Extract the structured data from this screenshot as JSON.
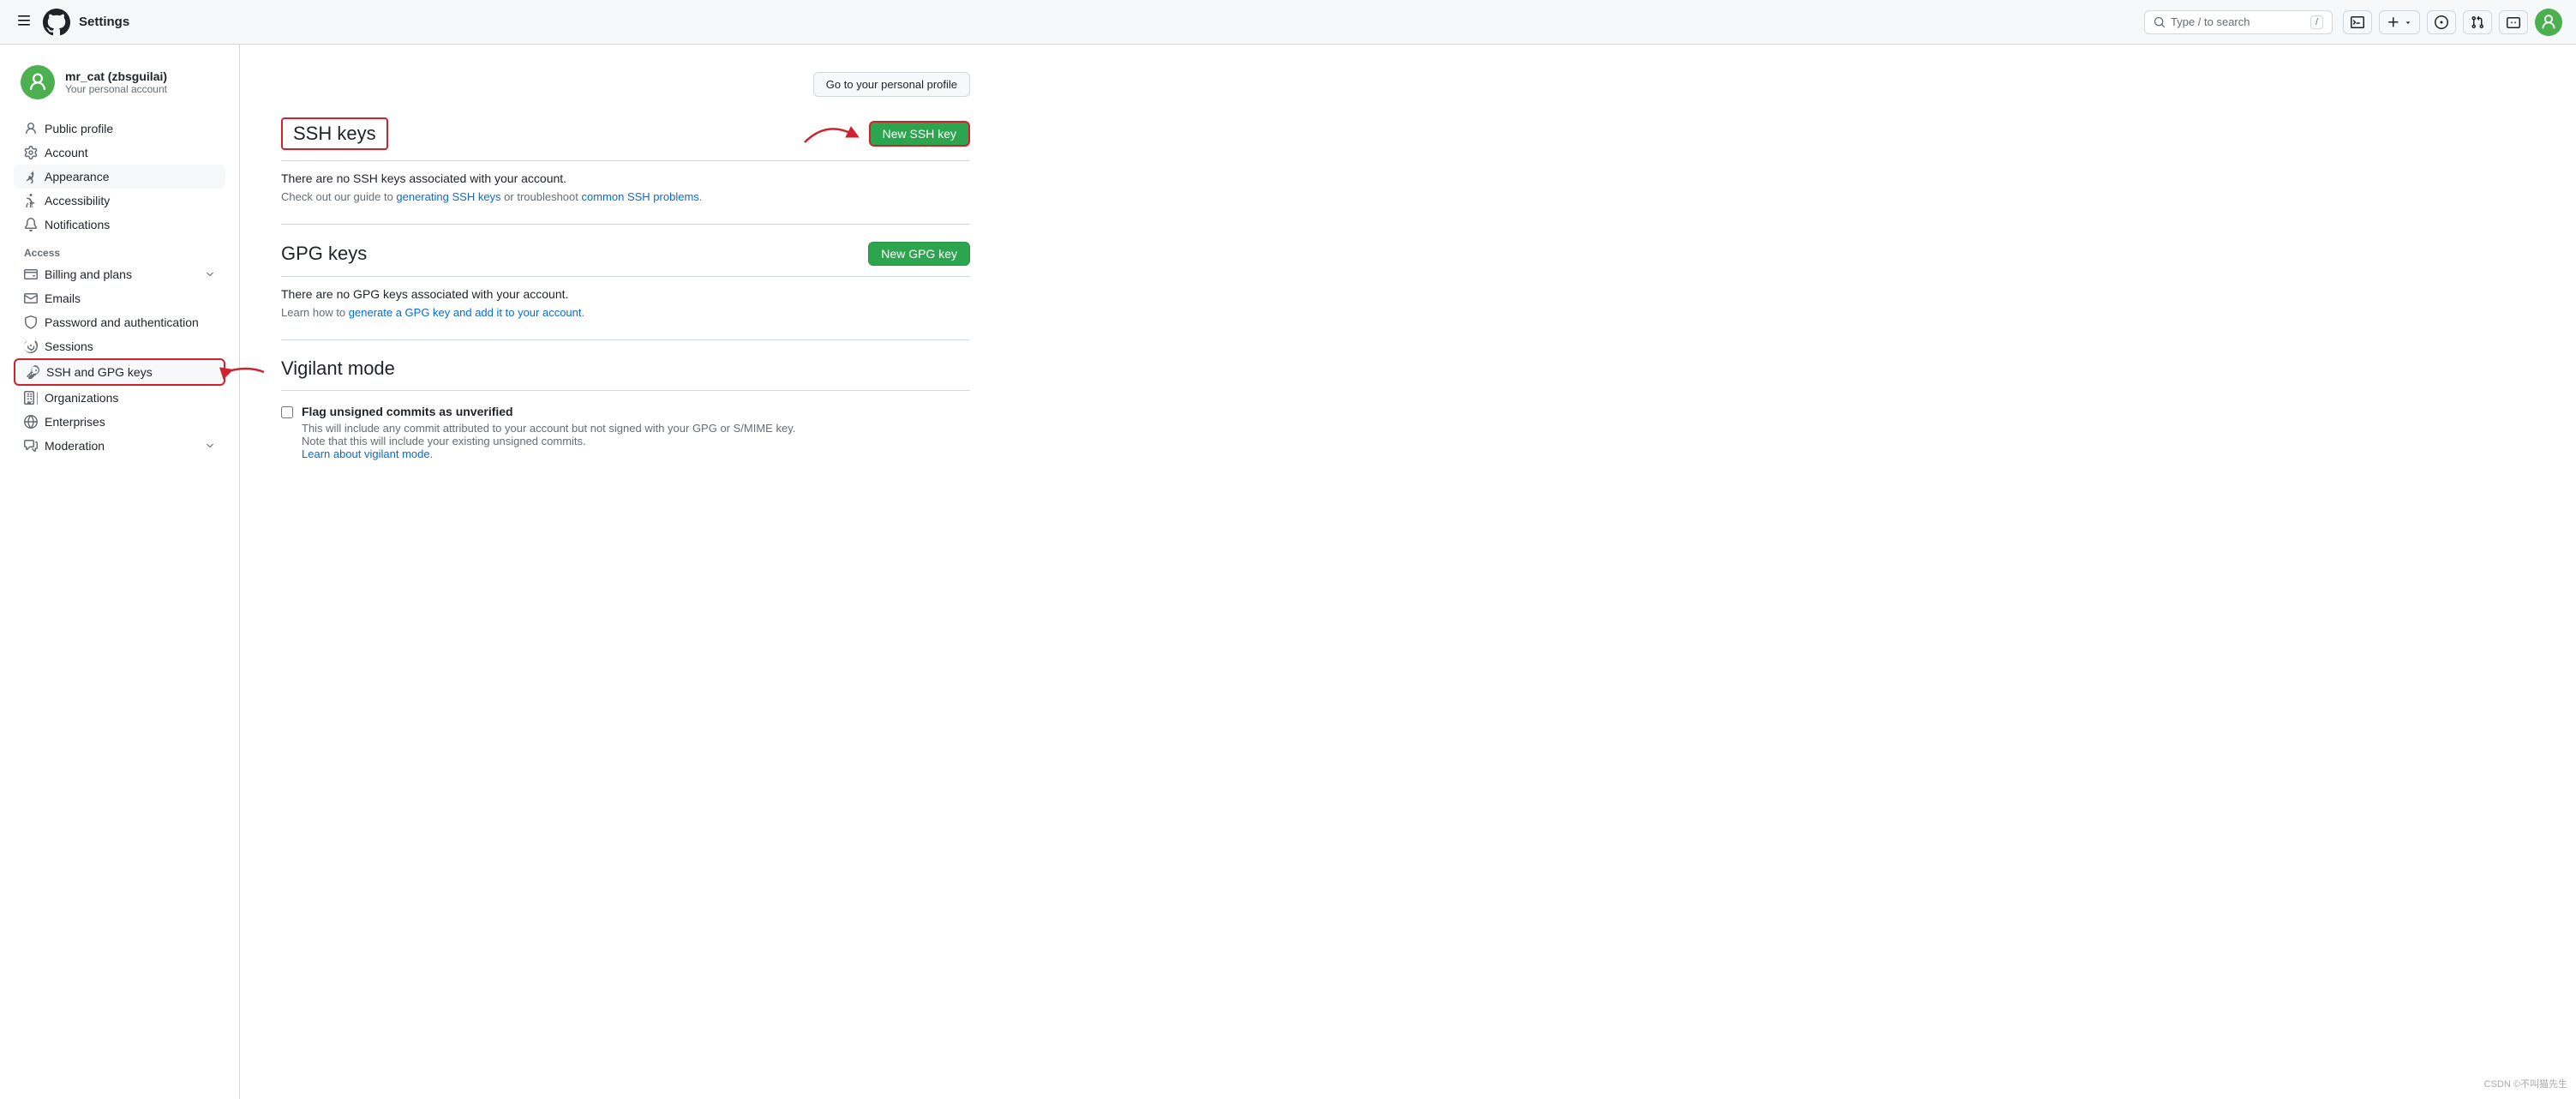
{
  "topnav": {
    "hamburger_label": "☰",
    "logo_alt": "GitHub",
    "title": "Settings",
    "search_placeholder": "Type / to search",
    "search_kbd": "/",
    "icons": {
      "terminal": ">_",
      "plus": "+",
      "issues": "⊙",
      "pullrequest": "⑂",
      "inbox": "✉",
      "user_initial": "✛"
    }
  },
  "sidebar": {
    "username": "mr_cat (zbsguilai)",
    "subtitle": "Your personal account",
    "go_to_profile_label": "Go to your personal profile",
    "nav": [
      {
        "id": "public-profile",
        "label": "Public profile",
        "icon": "person"
      },
      {
        "id": "account",
        "label": "Account",
        "icon": "gear"
      },
      {
        "id": "appearance",
        "label": "Appearance",
        "icon": "paintbrush",
        "active": true
      },
      {
        "id": "accessibility",
        "label": "Accessibility",
        "icon": "accessibility"
      },
      {
        "id": "notifications",
        "label": "Notifications",
        "icon": "bell"
      }
    ],
    "access_label": "Access",
    "access_nav": [
      {
        "id": "billing",
        "label": "Billing and plans",
        "icon": "card",
        "has_chevron": true
      },
      {
        "id": "emails",
        "label": "Emails",
        "icon": "mail"
      },
      {
        "id": "password",
        "label": "Password and authentication",
        "icon": "shield"
      },
      {
        "id": "sessions",
        "label": "Sessions",
        "icon": "broadcast"
      },
      {
        "id": "ssh-gpg",
        "label": "SSH and GPG keys",
        "icon": "key",
        "active": true
      },
      {
        "id": "organizations",
        "label": "Organizations",
        "icon": "organization"
      },
      {
        "id": "enterprises",
        "label": "Enterprises",
        "icon": "globe"
      },
      {
        "id": "moderation",
        "label": "Moderation",
        "icon": "comment",
        "has_chevron": true
      }
    ]
  },
  "main": {
    "ssh_section": {
      "title": "SSH keys",
      "new_btn": "New SSH key",
      "empty_msg": "There are no SSH keys associated with your account.",
      "help_prefix": "Check out our guide to ",
      "help_link1_text": "generating SSH keys",
      "help_link1_url": "#",
      "help_mid": " or troubleshoot ",
      "help_link2_text": "common SSH problems",
      "help_link2_url": "#",
      "help_suffix": "."
    },
    "gpg_section": {
      "title": "GPG keys",
      "new_btn": "New GPG key",
      "empty_msg": "There are no GPG keys associated with your account.",
      "help_prefix": "Learn how to ",
      "help_link1_text": "generate a GPG key and add it to your account",
      "help_link1_url": "#",
      "help_suffix": "."
    },
    "vigilant_section": {
      "title": "Vigilant mode",
      "checkbox_label": "Flag unsigned commits as unverified",
      "checkbox_desc1": "This will include any commit attributed to your account but not signed with your GPG or S/MIME key.",
      "checkbox_desc2": "Note that this will include your existing unsigned commits.",
      "learn_link_text": "Learn about vigilant mode",
      "learn_link_url": "#"
    }
  }
}
